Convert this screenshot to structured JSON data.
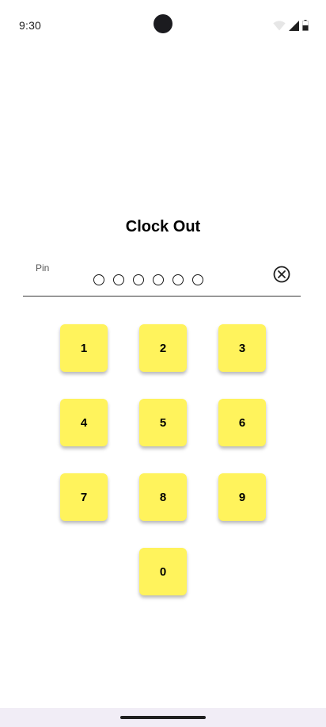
{
  "status_bar": {
    "time": "9:30",
    "icons": [
      "wifi-icon",
      "cell-signal-icon",
      "battery-icon"
    ]
  },
  "screen": {
    "title": "Clock Out"
  },
  "pin_field": {
    "label": "Pin",
    "length": 6,
    "filled": 0,
    "clear_icon": "clear-circle-x-icon"
  },
  "keypad": {
    "keys": [
      "1",
      "2",
      "3",
      "4",
      "5",
      "6",
      "7",
      "8",
      "9",
      "0"
    ],
    "key_color": "#fff35c"
  },
  "nav_bar": {
    "background": "#f1edf6"
  }
}
